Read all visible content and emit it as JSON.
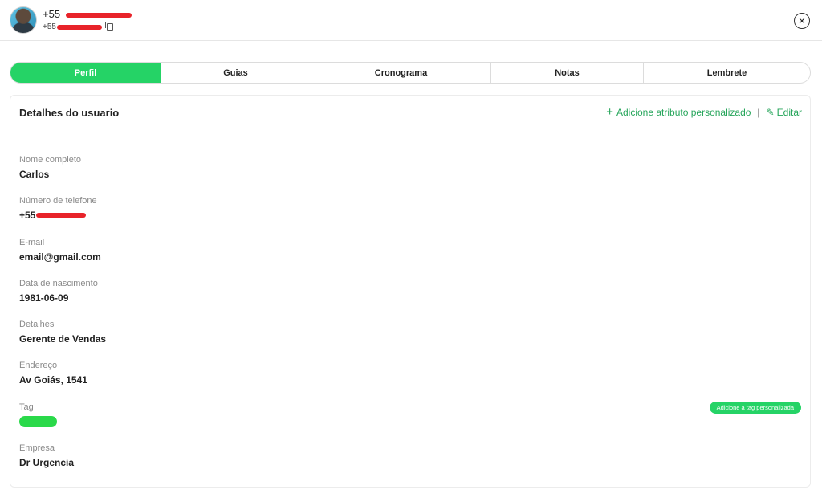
{
  "header": {
    "phone_prefix": "+55",
    "phone_sub_prefix": "+55"
  },
  "tabs": [
    {
      "label": "Perfil",
      "active": true
    },
    {
      "label": "Guias",
      "active": false
    },
    {
      "label": "Cronograma",
      "active": false
    },
    {
      "label": "Notas",
      "active": false
    },
    {
      "label": "Lembrete",
      "active": false
    }
  ],
  "details": {
    "title": "Detalhes do usuario",
    "add_attribute_label": "Adicione atributo personalizado",
    "separator": "|",
    "edit_label": "Editar",
    "add_tag_label": "Adicione a tag personalizada",
    "fields": [
      {
        "label": "Nome completo",
        "value": "Carlos"
      },
      {
        "label": "Número de telefone",
        "value": "+55"
      },
      {
        "label": "E-mail",
        "value": "email@gmail.com"
      },
      {
        "label": "Data de nascimento",
        "value": "1981-06-09"
      },
      {
        "label": "Detalhes",
        "value": "Gerente de Vendas"
      },
      {
        "label": "Endereço",
        "value": "Av Goiás, 1541"
      },
      {
        "label": "Tag",
        "value": ""
      },
      {
        "label": "Empresa",
        "value": "Dr Urgencia"
      }
    ]
  },
  "colors": {
    "accent": "#25d366",
    "tag": "#2ad94a",
    "link": "#25a55a",
    "redaction": "#e8232a"
  },
  "icons": [
    "avatar",
    "copy-icon",
    "close-icon",
    "plus-icon",
    "pencil-icon"
  ]
}
